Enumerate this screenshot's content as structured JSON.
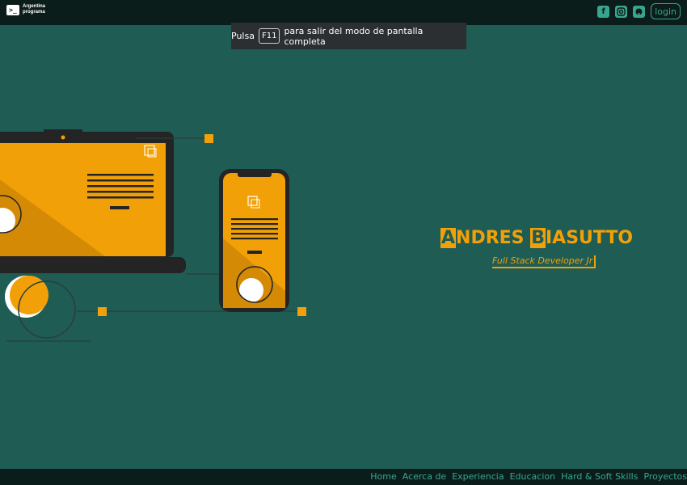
{
  "header": {
    "logo_line1": "Argentina",
    "logo_line2": "programa",
    "logo_symbol": ">_",
    "social_icons": [
      "facebook-icon",
      "instagram-icon",
      "github-icon"
    ],
    "login_label": "login"
  },
  "fullscreen_notice": {
    "prefix": "Pulsa",
    "key": "F11",
    "suffix": "para salir del modo de pantalla completa"
  },
  "hero": {
    "name_first_initial": "A",
    "name_first_rest": "NDRES",
    "name_last_initial": "B",
    "name_last_rest": "IASUTTO",
    "role": "Full Stack Developer Jr"
  },
  "nav": {
    "items": [
      "Home",
      "Acerca de",
      "Experiencia",
      "Educacion",
      "Hard & Soft Skills",
      "Proyectos"
    ]
  },
  "colors": {
    "background": "#1f5c54",
    "bar": "#0b1d1a",
    "accent": "#f2a007",
    "nav_text": "#3aa58e"
  }
}
